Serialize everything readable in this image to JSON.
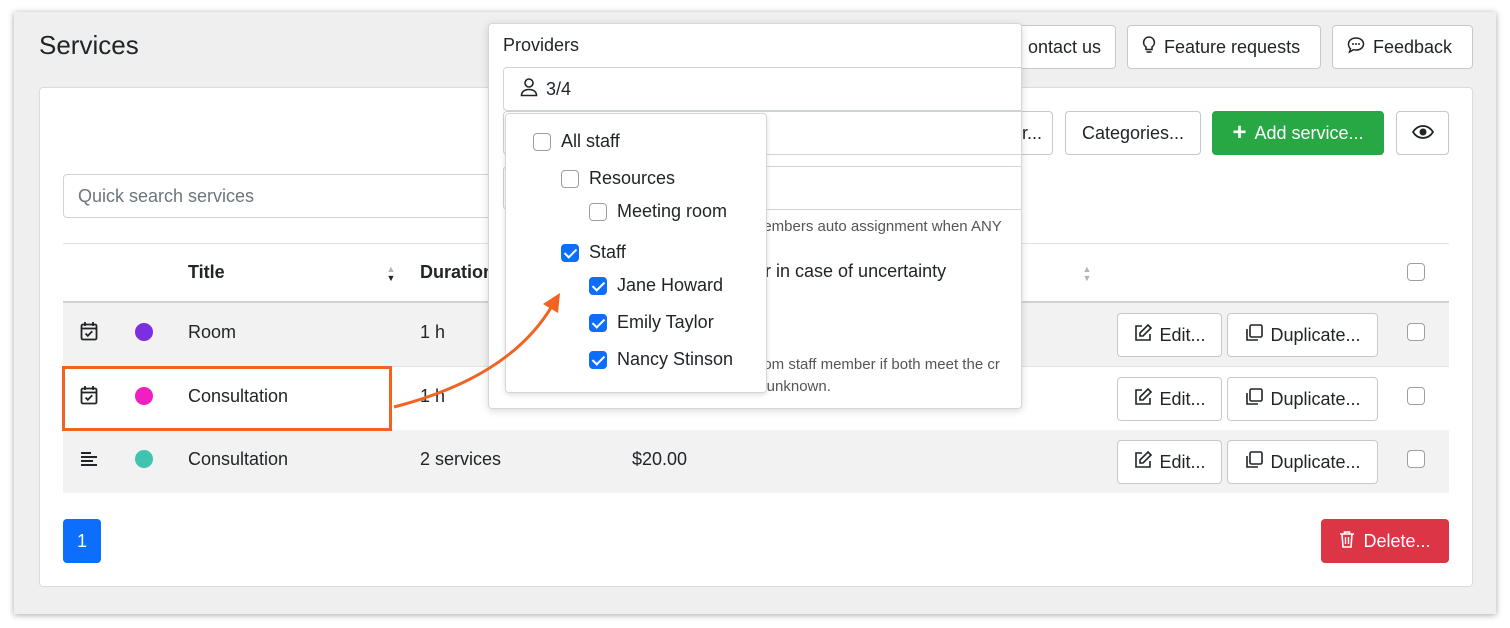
{
  "page": {
    "title": "Services"
  },
  "header_buttons": {
    "contact": "ontact us",
    "feature_requests": "Feature requests",
    "feedback": "Feedback"
  },
  "toolbar": {
    "partial_label": "r...",
    "categories": "Categories...",
    "add_service": "Add service...",
    "view_icon": "eye-icon"
  },
  "search": {
    "placeholder": "Quick search services"
  },
  "table": {
    "headers": {
      "title": "Title",
      "duration": "Duration"
    },
    "rows": [
      {
        "icon": "calendar-check-icon",
        "color": "#7b2fe0",
        "title": "Room",
        "duration": "1 h",
        "price": ""
      },
      {
        "icon": "calendar-check-icon",
        "color": "#f020c0",
        "title": "Consultation",
        "duration": "1 h",
        "price": ""
      },
      {
        "icon": "list-icon",
        "color": "#40c4b0",
        "title": "Consultation",
        "duration": "2 services",
        "price": "$20.00"
      }
    ],
    "edit_label": "Edit...",
    "duplicate_label": "Duplicate..."
  },
  "pagination": {
    "current": "1"
  },
  "delete_label": "Delete...",
  "popover": {
    "label": "Providers",
    "selected_count": "3/4",
    "bg_text_1": "nembers auto assignment when ANY",
    "bg_text_2": "er in case of uncertainty",
    "bg_text_3": "dom staff member if both meet the cr",
    "bg_text_4": "s unknown.",
    "items": {
      "all_staff": "All staff",
      "resources": "Resources",
      "meeting_room": "Meeting room",
      "staff": "Staff",
      "jane": "Jane Howard",
      "emily": "Emily Taylor",
      "nancy": "Nancy Stinson"
    }
  },
  "colors": {
    "primary": "#0d6efd",
    "success": "#28a745",
    "danger": "#dc3545",
    "annotation": "#f06320"
  }
}
